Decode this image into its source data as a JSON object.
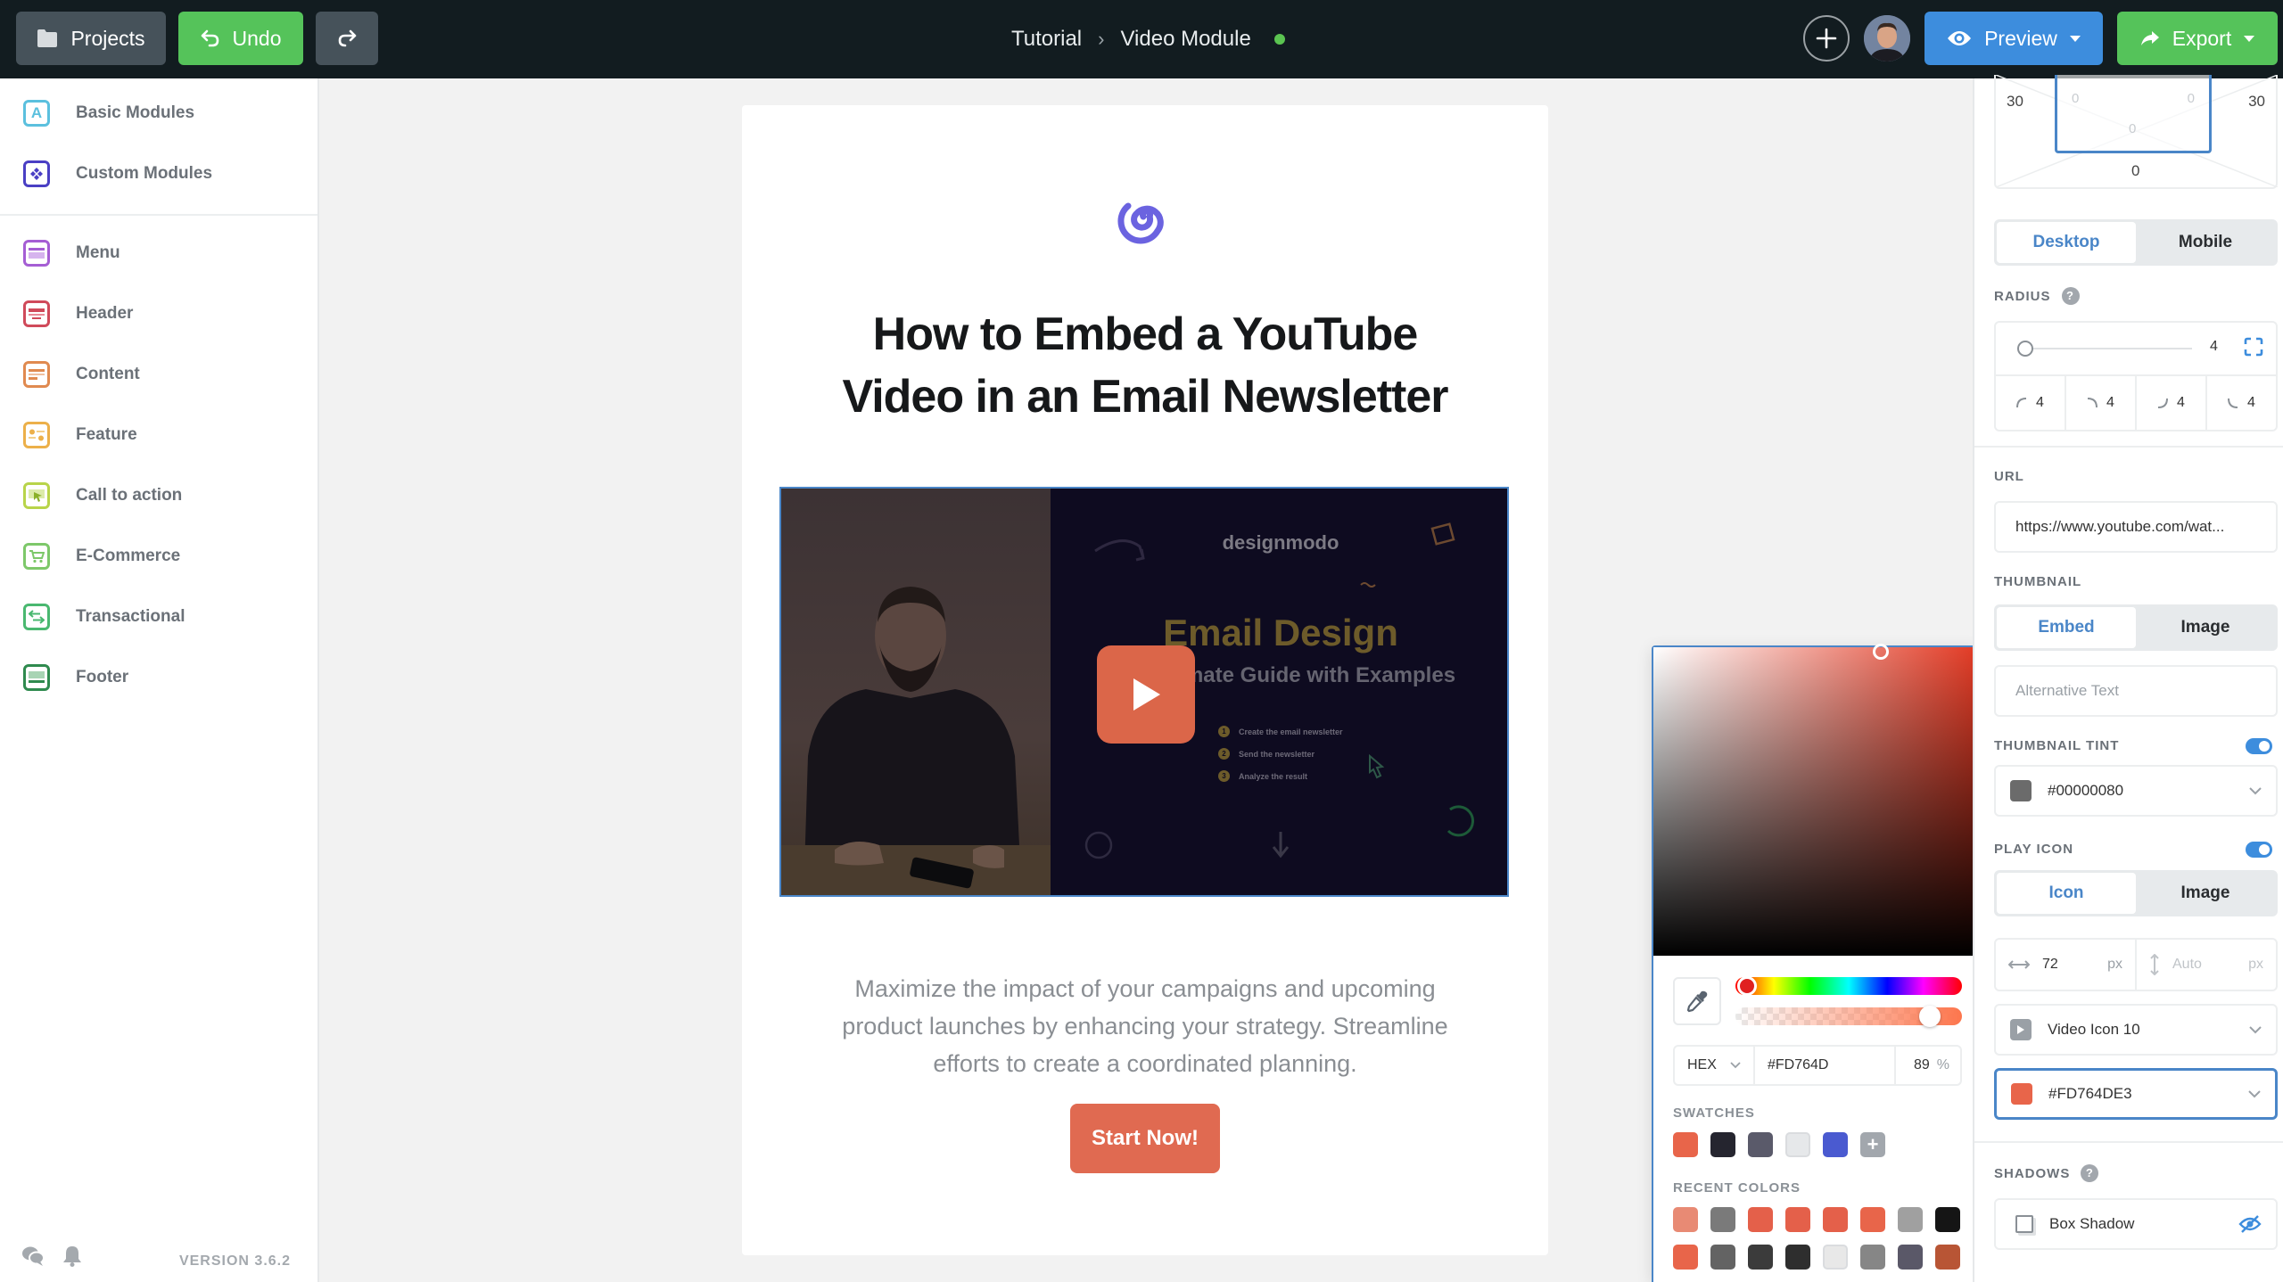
{
  "topbar": {
    "projects_label": "Projects",
    "undo_label": "Undo",
    "breadcrumb": [
      "Tutorial",
      "Video Module"
    ],
    "breadcrumb_separator": "›",
    "status": "saved",
    "status_color": "#5bc451",
    "preview_label": "Preview",
    "export_label": "Export"
  },
  "sidebar": {
    "top_items": [
      {
        "label": "Basic Modules",
        "icon": "letter-a-icon",
        "color": "#5bc0de"
      },
      {
        "label": "Custom Modules",
        "icon": "diamond-grid-icon",
        "color": "#4a3fc4"
      }
    ],
    "items": [
      {
        "label": "Menu",
        "icon": "menu-module-icon",
        "color": "#a55ed4"
      },
      {
        "label": "Header",
        "icon": "header-module-icon",
        "color": "#d04a5a"
      },
      {
        "label": "Content",
        "icon": "content-module-icon",
        "color": "#e08a50"
      },
      {
        "label": "Feature",
        "icon": "feature-module-icon",
        "color": "#ecb04a"
      },
      {
        "label": "Call to action",
        "icon": "cta-module-icon",
        "color": "#b8d44a"
      },
      {
        "label": "E-Commerce",
        "icon": "cart-icon",
        "color": "#7dc86a"
      },
      {
        "label": "Transactional",
        "icon": "transfer-icon",
        "color": "#4ab870"
      },
      {
        "label": "Footer",
        "icon": "footer-module-icon",
        "color": "#2f8a4e"
      }
    ],
    "version": "VERSION 3.6.2"
  },
  "email": {
    "headline_line1": "How to Embed a YouTube",
    "headline_line2": "Video in an Email Newsletter",
    "video": {
      "brand": "designmodo",
      "title": "Email Design",
      "subtitle": "The Ultimate Guide with Examples",
      "steps": [
        {
          "n": "1",
          "text": "Create the email newsletter"
        },
        {
          "n": "2",
          "text": "Send the newsletter"
        },
        {
          "n": "3",
          "text": "Analyze the result"
        }
      ]
    },
    "body_text": "Maximize the impact of your campaigns and upcoming product launches by enhancing your strategy. Streamline efforts to create a coordinated planning.",
    "cta_label": "Start Now!",
    "accent_color": "#e06a51"
  },
  "color_picker": {
    "mode": "HEX",
    "hex_value": "#FD764D",
    "alpha": "89",
    "alpha_unit": "%",
    "alpha_fraction": 0.89,
    "swatches_label": "SWATCHES",
    "swatches": [
      "#e8654a",
      "#25252f",
      "#5a5a6a",
      "#e6e8ea",
      "#4a5ad0"
    ],
    "recent_label": "RECENT COLORS",
    "recent_colors": [
      "#e88a74",
      "#7a7a7a",
      "#e4604a",
      "#e4604a",
      "#e4604a",
      "#e8654a",
      "#a0a0a0",
      "#151515",
      "#e8654a",
      "#636363",
      "#3b3b3b",
      "#2e2e2e",
      "#e8e8e8",
      "#868686",
      "#5a5868",
      "#b85535"
    ]
  },
  "panel": {
    "padding": {
      "left": "30",
      "right": "30",
      "bottom": "0",
      "inner_left": "0",
      "inner_right": "0",
      "inner_bottom": "0"
    },
    "device_tabs": [
      "Desktop",
      "Mobile"
    ],
    "device_active": "Desktop",
    "radius_label": "RADIUS",
    "radius_value": "4",
    "radius_slider_fraction": 0.04,
    "radius_corners": [
      "4",
      "4",
      "4",
      "4"
    ],
    "url_label": "URL",
    "url_value": "https://www.youtube.com/wat...",
    "thumbnail_label": "THUMBNAIL",
    "thumbnail_tabs": [
      "Embed",
      "Image"
    ],
    "thumbnail_active": "Embed",
    "alt_placeholder": "Alternative Text",
    "tint_label": "THUMBNAIL TINT",
    "tint_enabled": true,
    "tint_value": "#00000080",
    "tint_swatch": "#6b6b6b",
    "play_icon_label": "PLAY ICON",
    "play_icon_enabled": true,
    "play_icon_tabs": [
      "Icon",
      "Image"
    ],
    "play_icon_active": "Icon",
    "width_value": "72",
    "width_unit": "px",
    "height_placeholder": "Auto",
    "height_unit": "px",
    "icon_select": "Video Icon 10",
    "icon_color": "#FD764DE3",
    "icon_color_swatch": "#e8654a",
    "shadows_label": "SHADOWS",
    "box_shadow_label": "Box Shadow"
  }
}
